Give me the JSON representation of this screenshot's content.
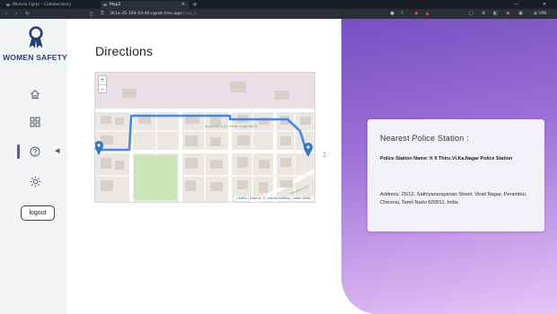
{
  "browser": {
    "tabs": [
      {
        "title": "Module Cgrpr - Collaboratory",
        "active": false
      },
      {
        "title": "Map2",
        "active": true
      }
    ],
    "url": {
      "main": "361e-35-194-43-46.ngrok-free.app",
      "path": "/map_2"
    },
    "vpn_label": "VPN"
  },
  "sidebar": {
    "logo_text": "WOMEN SAFETY",
    "nav": [
      {
        "icon": "home-icon"
      },
      {
        "icon": "grid-icon"
      },
      {
        "icon": "help-icon",
        "active": true
      },
      {
        "icon": "sun-icon"
      }
    ],
    "logout_label": "logout"
  },
  "main": {
    "title": "Directions",
    "map": {
      "zoom_in": "+",
      "zoom_out": "−",
      "streets": [
        "Ilango 6th Cross Street",
        "Ilango 6th St",
        "Perambur Sul"
      ],
      "attribution_leaflet": "Leaflet",
      "attribution_rest": " | Data by © ",
      "attribution_osm": "OpenStreetMap",
      "attribution_tail": ", under ODbL."
    }
  },
  "info_card": {
    "heading": "Nearest Police Station :",
    "station_name": "Police Station Name: K 9 Thiru.Vi.Ka.Nagar Police Station",
    "address": "Address: 25/12, Sathiyanarayanan Street, Virati Nagar, Perambur, Chennai, Tamil Nadu 600011, India"
  },
  "colors": {
    "accent": "#6a4fc2",
    "route": "#3b82e6",
    "marker": "#2f7ac2",
    "logo": "#2a3f77",
    "panel_top": "#7650c2",
    "panel_bottom": "#e4c6f7"
  }
}
